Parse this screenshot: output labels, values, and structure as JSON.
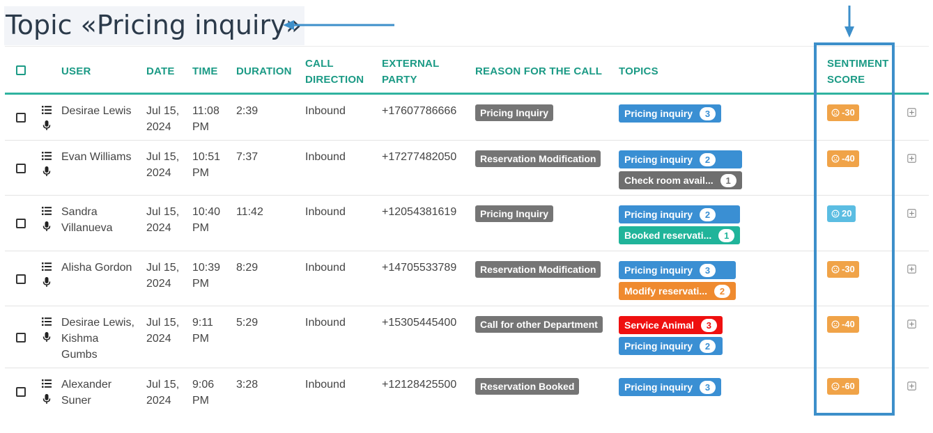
{
  "title": "Topic «Pricing inquiry»",
  "colors": {
    "accent": "#1b9a85",
    "highlight": "#3d8fca",
    "reason_tag": "#757575",
    "negative_sentiment": "#f0a348",
    "positive_sentiment": "#5bbde2"
  },
  "icons": {
    "header_select": "checkbox-icon",
    "transcript": "list-icon",
    "recording": "microphone-icon",
    "expand": "plus-square-icon",
    "negative": "frown-face-icon",
    "positive": "smile-face-icon"
  },
  "columns": {
    "user": "USER",
    "date": "DATE",
    "time": "TIME",
    "duration": "DURATION",
    "call_direction_1": "CALL",
    "call_direction_2": "DIRECTION",
    "external_party_1": "EXTERNAL",
    "external_party_2": "PARTY",
    "reason": "REASON FOR THE CALL",
    "topics": "TOPICS",
    "sentiment_1": "SENTIMENT",
    "sentiment_2": "SCORE"
  },
  "rows": [
    {
      "user_lines": [
        "Desirae Lewis"
      ],
      "date": [
        "Jul 15,",
        "2024"
      ],
      "time": [
        "11:08",
        "PM"
      ],
      "duration": "2:39",
      "direction": "Inbound",
      "external": "+17607786666",
      "reason": "Pricing Inquiry",
      "topics": [
        {
          "label": "Pricing inquiry",
          "count": "3",
          "color": "#3a8fd3"
        }
      ],
      "sentiment": "-30",
      "sentiment_color": "#f0a348"
    },
    {
      "user_lines": [
        "Evan Williams"
      ],
      "date": [
        "Jul 15,",
        "2024"
      ],
      "time": [
        "10:51",
        "PM"
      ],
      "duration": "7:37",
      "direction": "Inbound",
      "external": "+17277482050",
      "reason": "Reservation Modification",
      "topics": [
        {
          "label": "Pricing inquiry",
          "count": "2",
          "color": "#3a8fd3"
        },
        {
          "label": "Check room avail...",
          "count": "1",
          "color": "#6f6f6f"
        }
      ],
      "sentiment": "-40",
      "sentiment_color": "#f0a348"
    },
    {
      "user_lines": [
        "Sandra",
        "Villanueva"
      ],
      "date": [
        "Jul 15,",
        "2024"
      ],
      "time": [
        "10:40",
        "PM"
      ],
      "duration": "11:42",
      "direction": "Inbound",
      "external": "+12054381619",
      "reason": "Pricing Inquiry",
      "topics": [
        {
          "label": "Pricing inquiry",
          "count": "2",
          "color": "#3a8fd3"
        },
        {
          "label": "Booked reservati...",
          "count": "1",
          "color": "#20b49a"
        }
      ],
      "sentiment": "20",
      "sentiment_color": "#5bbde2"
    },
    {
      "user_lines": [
        "Alisha Gordon"
      ],
      "date": [
        "Jul 15,",
        "2024"
      ],
      "time": [
        "10:39",
        "PM"
      ],
      "duration": "8:29",
      "direction": "Inbound",
      "external": "+14705533789",
      "reason": "Reservation Modification",
      "topics": [
        {
          "label": "Pricing inquiry",
          "count": "3",
          "color": "#3a8fd3"
        },
        {
          "label": "Modify reservati...",
          "count": "2",
          "color": "#ef8a2f"
        }
      ],
      "sentiment": "-30",
      "sentiment_color": "#f0a348"
    },
    {
      "user_lines": [
        "Desirae Lewis,",
        "Kishma",
        "Gumbs"
      ],
      "date": [
        "Jul 15,",
        "2024"
      ],
      "time": [
        "9:11",
        "PM"
      ],
      "duration": "5:29",
      "direction": "Inbound",
      "external": "+15305445400",
      "reason": "Call for other Department",
      "topics": [
        {
          "label": "Service Animal",
          "count": "3",
          "color": "#ef1010"
        },
        {
          "label": "Pricing inquiry",
          "count": "2",
          "color": "#3a8fd3"
        }
      ],
      "sentiment": "-40",
      "sentiment_color": "#f0a348"
    },
    {
      "user_lines": [
        "Alexander",
        "Suner"
      ],
      "date": [
        "Jul 15,",
        "2024"
      ],
      "time": [
        "9:06",
        "PM"
      ],
      "duration": "3:28",
      "direction": "Inbound",
      "external": "+12128425500",
      "reason": "Reservation Booked",
      "topics": [
        {
          "label": "Pricing inquiry",
          "count": "3",
          "color": "#3a8fd3"
        }
      ],
      "sentiment": "-60",
      "sentiment_color": "#f0a348"
    }
  ]
}
